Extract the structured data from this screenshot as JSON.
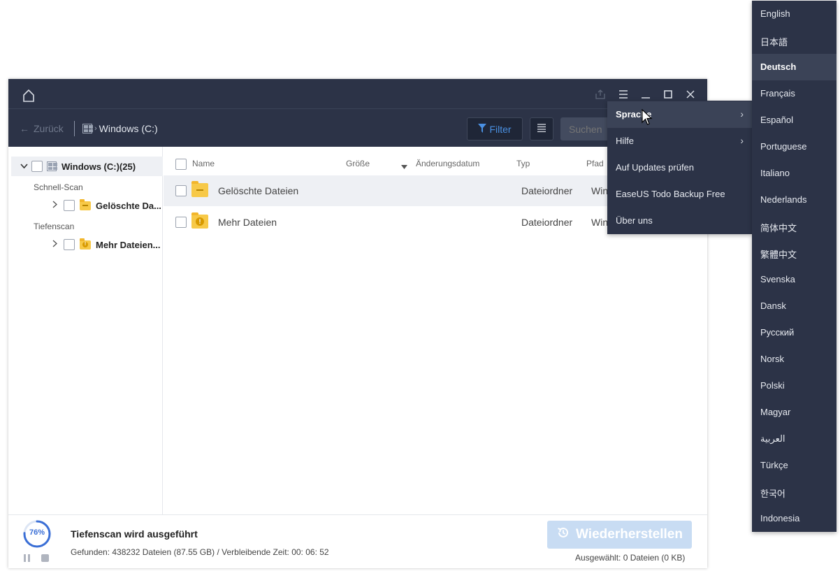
{
  "window": {
    "breadcrumb_drive": "Windows (C:)",
    "back_label": "Zurück",
    "filter_label": "Filter",
    "search_placeholder": "Suchen"
  },
  "tree": {
    "root_label": "Windows (C:)(25)",
    "quick_scan_label": "Schnell-Scan",
    "deep_scan_label": "Tiefenscan",
    "items": [
      {
        "label": "Gelöschte Da..."
      },
      {
        "label": "Mehr Dateien..."
      }
    ]
  },
  "table": {
    "columns": [
      "Name",
      "Größe",
      "Änderungsdatum",
      "Typ",
      "Pfad"
    ],
    "rows": [
      {
        "name": "Gelöschte Dateien",
        "type": "Dateiordner",
        "path": "Win"
      },
      {
        "name": "Mehr Dateien",
        "type": "Dateiordner",
        "path": "Win"
      }
    ]
  },
  "footer": {
    "progress_percent": 76,
    "progress_label": "76%",
    "scan_title": "Tiefenscan wird ausgeführt",
    "scan_status": "Gefunden: 438232 Dateien (87.55 GB) / Verbleibende Zeit: 00: 06: 52",
    "restore_label": "Wiederherstellen",
    "selected_text": "Ausgewählt: 0 Dateien (0 KB)"
  },
  "main_menu": {
    "items": [
      {
        "label": "Sprache",
        "has_submenu": true
      },
      {
        "label": "Hilfe",
        "has_submenu": true
      },
      {
        "label": "Auf Updates prüfen"
      },
      {
        "label": "EaseUS Todo Backup Free"
      },
      {
        "label": "Über uns"
      }
    ]
  },
  "languages": {
    "selected": "Deutsch",
    "items": [
      "English",
      "日本語",
      "Deutsch",
      "Français",
      "Español",
      "Portuguese",
      "Italiano",
      "Nederlands",
      "简体中文",
      "繁體中文",
      "Svenska",
      "Dansk",
      "Русский",
      "Norsk",
      "Polski",
      "Magyar",
      "العربية",
      "Türkçe",
      "한국어",
      "Indonesia"
    ]
  },
  "colors": {
    "titlebar": "#2c3347",
    "accent": "#4a90e2",
    "folder": "#f7c948",
    "restore_disabled": "#c8dcf3"
  }
}
